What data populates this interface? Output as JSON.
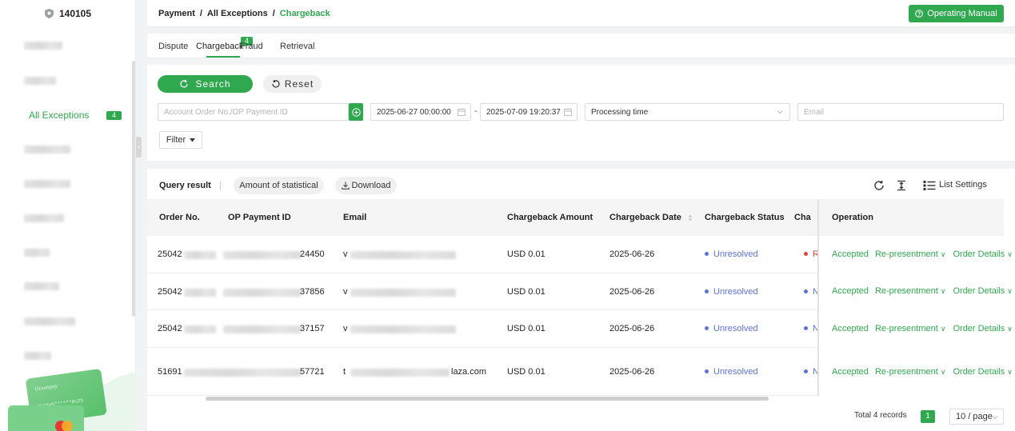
{
  "sidebar": {
    "merchant_id": "140105",
    "active_item": {
      "label": "All Exceptions",
      "badge": "4"
    }
  },
  "header": {
    "breadcrumb": [
      "Payment",
      "All Exceptions",
      "Chargeback"
    ],
    "separator": "/",
    "manual_button": "Operating Manual"
  },
  "tabs": [
    {
      "label": "Dispute"
    },
    {
      "label": "Chargeback",
      "badge": "4",
      "active": true
    },
    {
      "label": "Fraud"
    },
    {
      "label": "Retrieval"
    }
  ],
  "search": {
    "search_label": "Search",
    "reset_label": "Reset",
    "order_placeholder": "Account Order No./OP Payment ID",
    "date_from": "2025-06-27 00:00:00",
    "date_sep": "-",
    "date_to": "2025-07-09 19:20:37",
    "time_type": "Processing time",
    "email_placeholder": "Email",
    "filter_label": "Filter"
  },
  "results": {
    "title": "Query result",
    "stat_button": "Amount of statistical",
    "download_button": "Download",
    "list_settings": "List Settings",
    "columns": {
      "order_no": "Order No.",
      "op_payment_id": "OP Payment ID",
      "email": "Email",
      "amount": "Chargeback Amount",
      "date": "Chargeback Date",
      "status": "Chargeback Status",
      "cha": "Cha",
      "operation": "Operation"
    },
    "rows": [
      {
        "order": "25042",
        "opid": "24450",
        "email_prefix": "v",
        "email_suffix": "",
        "amount": "USD 0.01",
        "date": "2025-06-26",
        "status": "Unresolved",
        "cha": "R",
        "cha_color": "#e8453c"
      },
      {
        "order": "25042",
        "opid": "37856",
        "email_prefix": "v",
        "email_suffix": "",
        "amount": "USD 0.01",
        "date": "2025-06-26",
        "status": "Unresolved",
        "cha": "N",
        "cha_color": "#5b73d6"
      },
      {
        "order": "25042",
        "opid": "37157",
        "email_prefix": "v",
        "email_suffix": "",
        "amount": "USD 0.01",
        "date": "2025-06-26",
        "status": "Unresolved",
        "cha": "N",
        "cha_color": "#5b73d6"
      },
      {
        "order": "51691",
        "opid": "57721",
        "email_prefix": "t",
        "email_suffix": "laza.com",
        "amount": "USD 0.01",
        "date": "2025-06-26",
        "status": "Unresolved",
        "cha": "N",
        "cha_color": "#5b73d6"
      }
    ],
    "operations": {
      "accepted": "Accepted",
      "represent": "Re-presentment",
      "details": "Order Details"
    },
    "pagination": {
      "total": "Total 4 records",
      "page": "1",
      "page_size": "10 / page"
    }
  },
  "colors": {
    "primary": "#2fa84f",
    "status_blue": "#5b73d6",
    "alert_red": "#e8453c"
  }
}
